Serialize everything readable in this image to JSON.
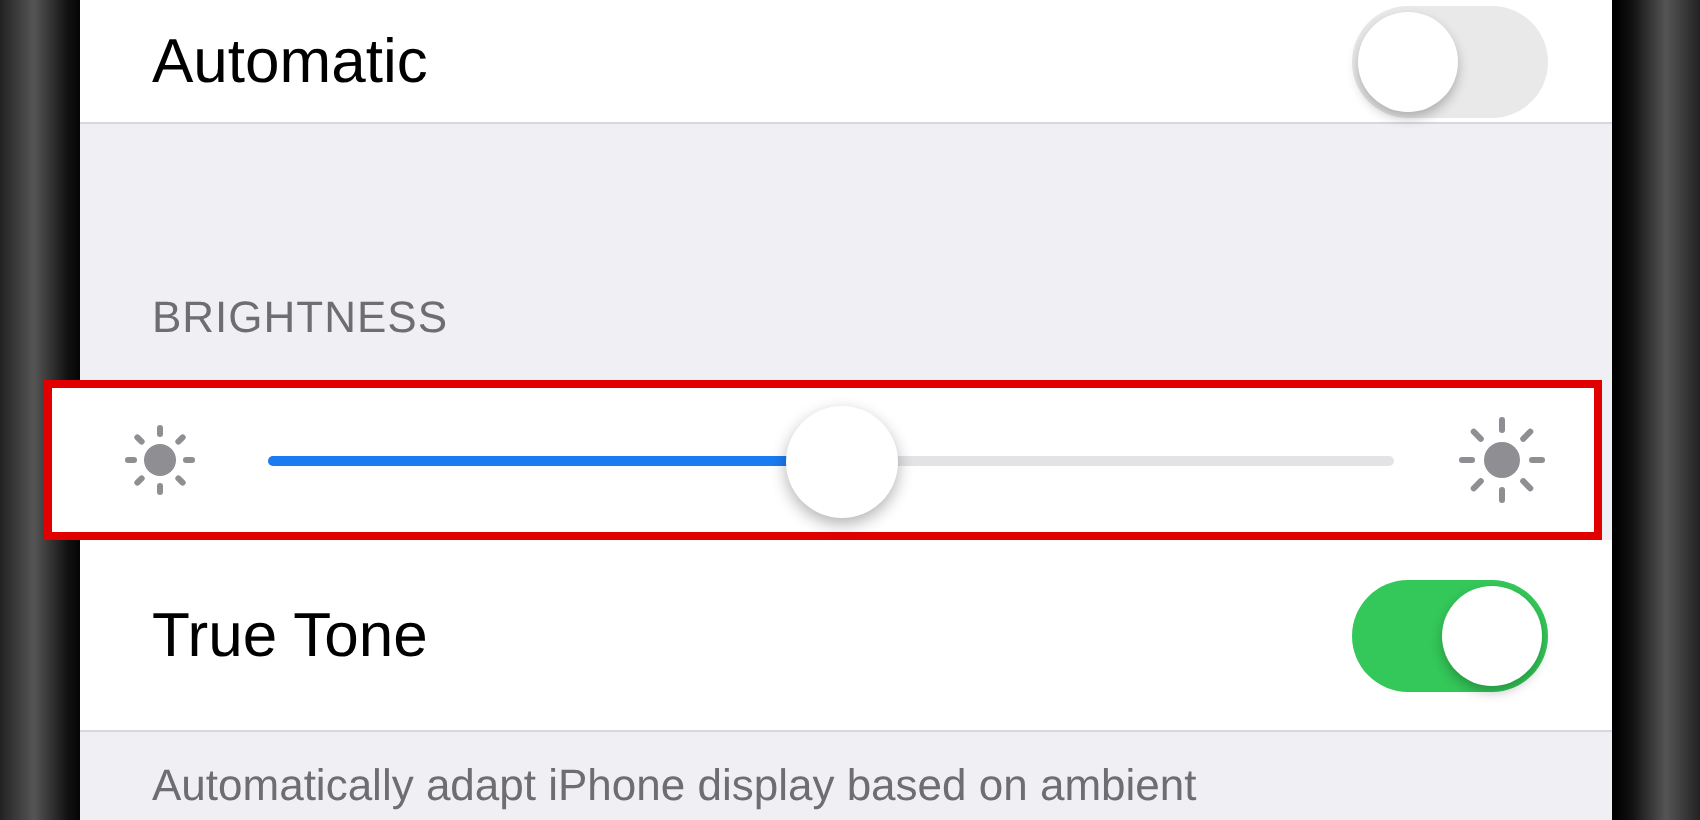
{
  "rows_top": [
    {
      "label": "Automatic",
      "on": false
    }
  ],
  "brightness": {
    "header": "BRIGHTNESS",
    "level": 0.51
  },
  "rows_bottom": [
    {
      "label": "True Tone",
      "on": true
    }
  ],
  "footer": "Automatically adapt iPhone display based on ambient"
}
